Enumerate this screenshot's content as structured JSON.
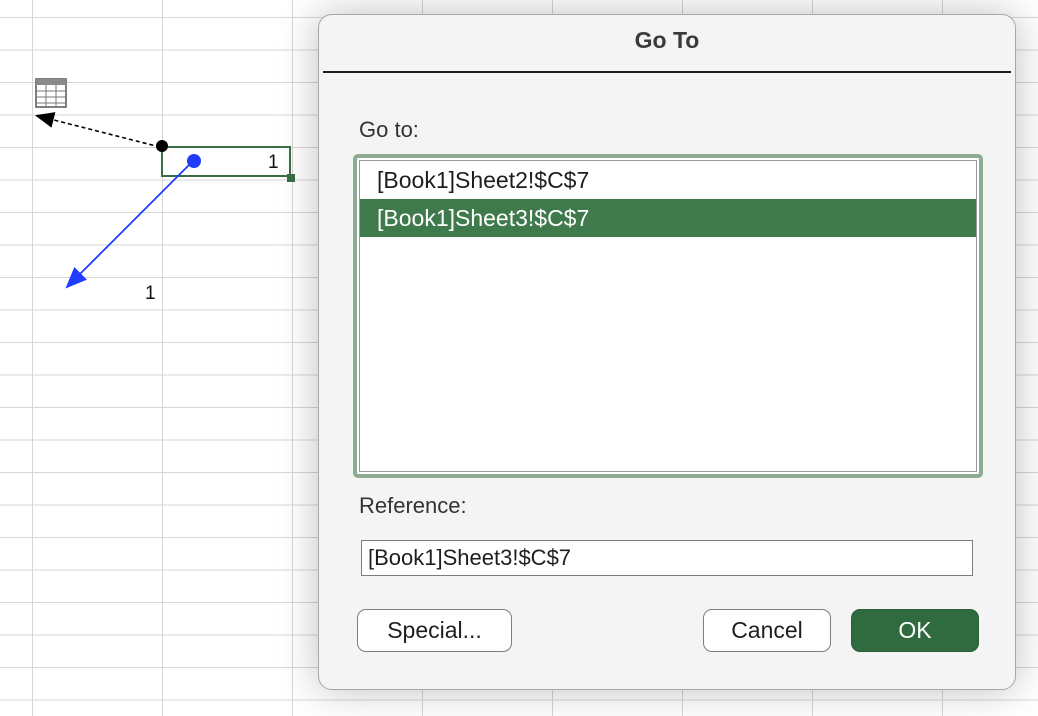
{
  "sheet": {
    "cell_value": "1",
    "arrow_label": "1",
    "icons": {
      "table": "table-icon"
    },
    "colors": {
      "selection": "#3a6e47",
      "precedent_arrow": "#1f3cff",
      "dependent_arrow": "#000000"
    }
  },
  "dialog": {
    "title": "Go To",
    "goto_label": "Go to:",
    "items": [
      {
        "label": "[Book1]Sheet2!$C$7",
        "selected": false
      },
      {
        "label": "[Book1]Sheet3!$C$7",
        "selected": true
      }
    ],
    "reference_label": "Reference:",
    "reference_value": "[Book1]Sheet3!$C$7",
    "buttons": {
      "special": "Special...",
      "cancel": "Cancel",
      "ok": "OK"
    },
    "colors": {
      "accent": "#2f6b3e",
      "selection": "#3f7a4c",
      "focus_ring": "#8daa92"
    }
  }
}
